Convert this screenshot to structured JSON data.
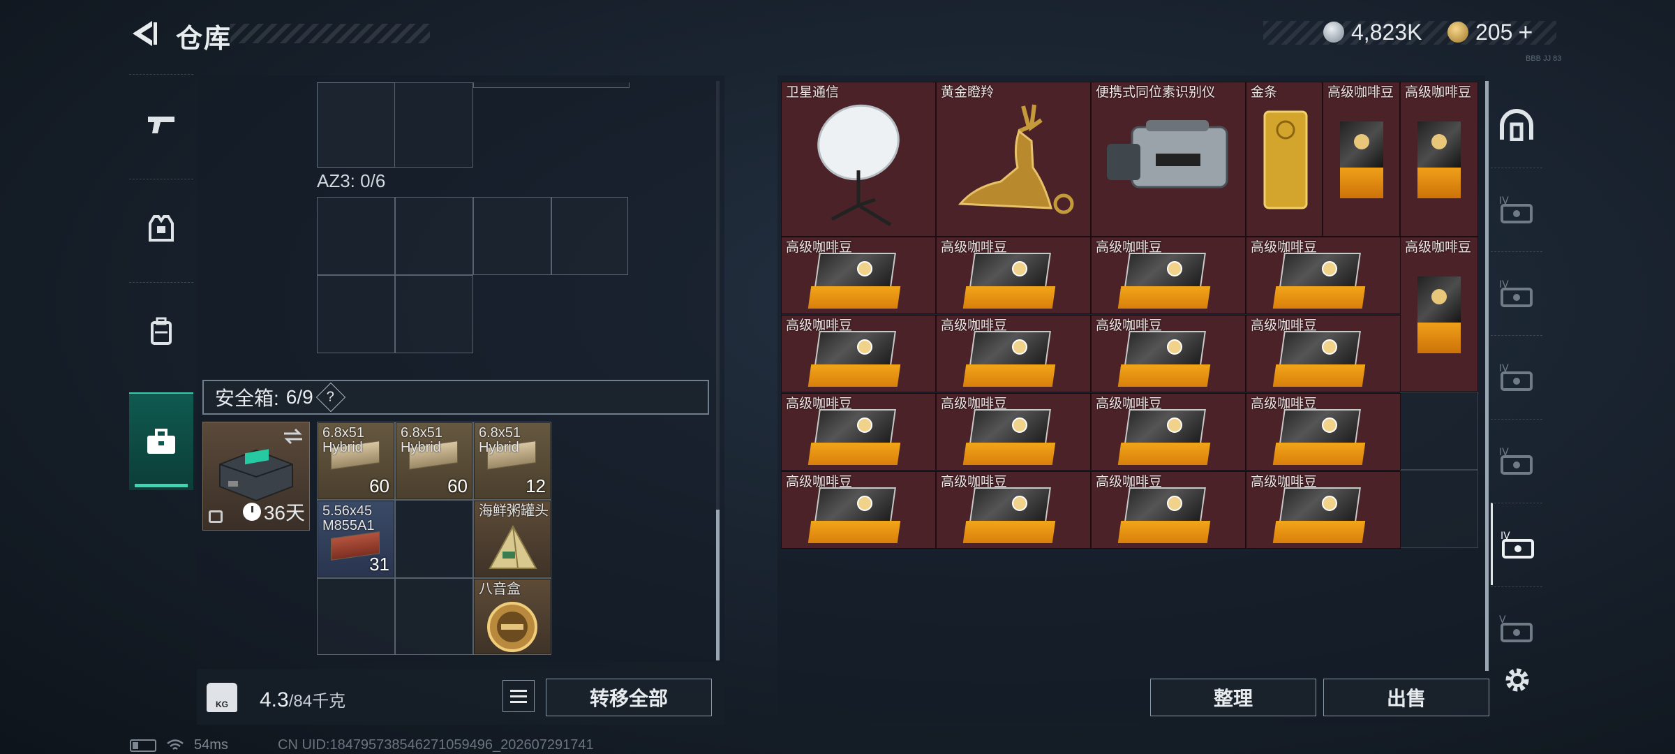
{
  "header": {
    "title": "仓库",
    "currency1": "4,823K",
    "currency2": "205",
    "plus": "+",
    "tiny_text": "BBB JJ 83"
  },
  "left_panel": {
    "az3_label": "AZ3: 0/6",
    "safebox_label": "安全箱:",
    "safebox_count": "6/9",
    "safebox_help": "?",
    "safebox_days": "36天",
    "safebox_items": [
      {
        "name": "6.8x51 Hybrid",
        "qty": "60"
      },
      {
        "name": "6.8x51 Hybrid",
        "qty": "60"
      },
      {
        "name": "6.8x51 Hybrid",
        "qty": "12"
      },
      {
        "name": "5.56x45 M855A1",
        "qty": "31"
      },
      {
        "name": "海鲜粥罐头",
        "qty": ""
      },
      {
        "name": "八音盒",
        "qty": ""
      }
    ],
    "weight_icon": "KG",
    "weight_current": "4.3",
    "weight_max": "/84千克",
    "transfer_all": "转移全部"
  },
  "right_panel": {
    "top_items": [
      {
        "name": "卫星通信"
      },
      {
        "name": "黄金瞪羚"
      },
      {
        "name": "便携式同位素识别仪"
      },
      {
        "name": "金条"
      },
      {
        "name": "高级咖啡豆"
      },
      {
        "name": "高级咖啡豆"
      }
    ],
    "coffee_label": "高级咖啡豆",
    "sort_button": "整理",
    "sell_button": "出售"
  },
  "status_bar": {
    "ping": "54ms",
    "uid": "CN UID:18479573854627105949​6_202607291741"
  },
  "colors": {
    "accent_teal": "#3fd5b2",
    "item_red_bg": "#4b2228",
    "coffee_orange": "#f2a519"
  },
  "icons": {
    "back": "chevron-left-icon",
    "tabs": [
      "gun-icon",
      "armor-vest-icon",
      "backpack-icon",
      "briefcase-icon"
    ],
    "right_tabs": [
      "dome-icon",
      "case-iv-icon",
      "case-iv-icon",
      "case-iv-icon",
      "case-iv-icon",
      "case-iv-icon",
      "case-v-icon"
    ],
    "settings": "gear-icon"
  }
}
